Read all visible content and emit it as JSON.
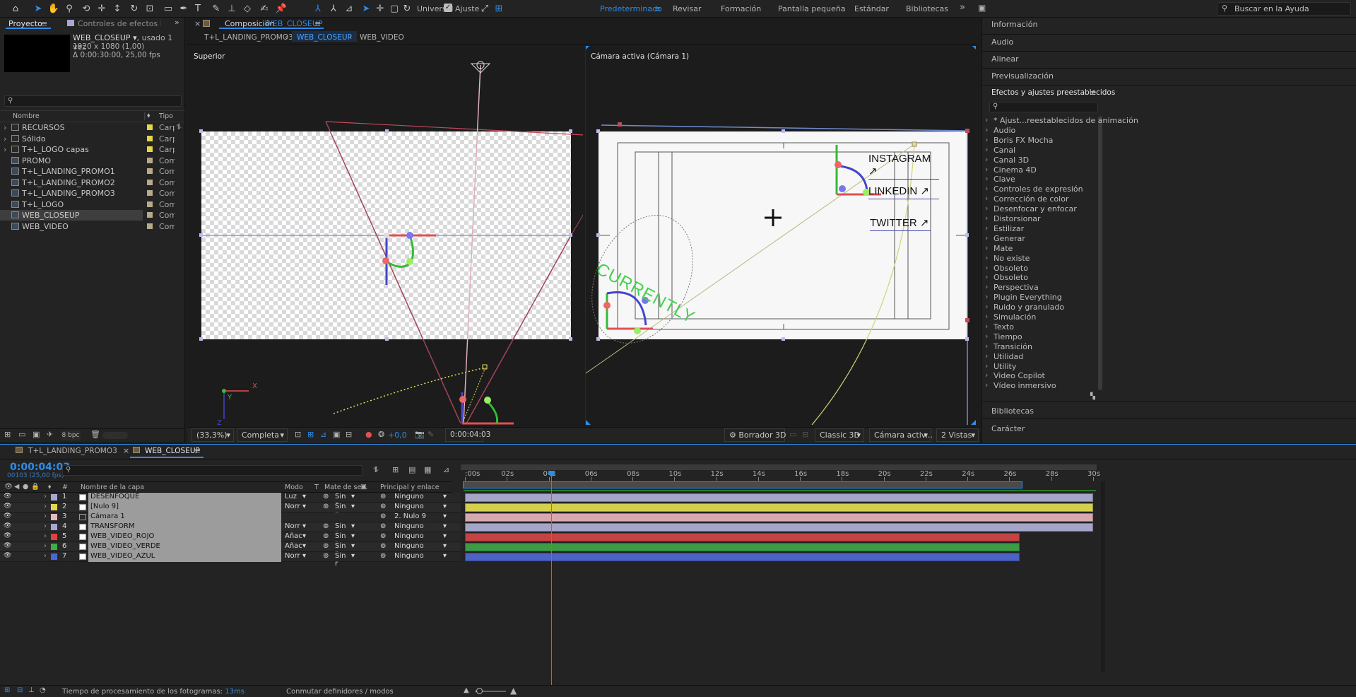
{
  "toolbar": {
    "universal_label": "Universal",
    "snap_label": "Ajuste",
    "workspaces": [
      "Predeterminado",
      "Revisar",
      "Formación",
      "Pantalla pequeña",
      "Estándar",
      "Bibliotecas"
    ],
    "search_help_placeholder": "Buscar en la Ayuda"
  },
  "project_panel": {
    "tab_project": "Proyecto",
    "tab_effects_controls": "Controles de efectos DESENFOQUE",
    "selected_name": "WEB_CLOSEUP",
    "selected_usage": ", usado 1 vez",
    "selected_dims": "1920 x 1080 (1,00)",
    "selected_duration": "Δ 0:00:30:00, 25,00 fps",
    "col_name": "Nombre",
    "col_type": "Tipo",
    "items": [
      {
        "name": "RECURSOS",
        "type": "Carpeta",
        "kind": "folder"
      },
      {
        "name": "Sólido",
        "type": "Carpeta",
        "kind": "folder"
      },
      {
        "name": "T+L_LOGO capas",
        "type": "Carpeta",
        "kind": "folder"
      },
      {
        "name": "PROMO",
        "type": "Comp",
        "kind": "comp"
      },
      {
        "name": "T+L_LANDING_PROMO1",
        "type": "Comp",
        "kind": "comp"
      },
      {
        "name": "T+L_LANDING_PROMO2",
        "type": "Comp",
        "kind": "comp"
      },
      {
        "name": "T+L_LANDING_PROMO3",
        "type": "Comp",
        "kind": "comp"
      },
      {
        "name": "T+L_LOGO",
        "type": "Comp",
        "kind": "comp"
      },
      {
        "name": "WEB_CLOSEUP",
        "type": "Comp",
        "kind": "comp",
        "selected": true
      },
      {
        "name": "WEB_VIDEO",
        "type": "Comp",
        "kind": "comp"
      }
    ],
    "bpc_label": "8 bpc"
  },
  "composition": {
    "tab_prefix": "Composición",
    "tab_name": "WEB_CLOSEUP",
    "breadcrumbs": [
      "T+L_LANDING_PROMO3",
      "WEB_CLOSEUP",
      "WEB_VIDEO"
    ],
    "view_left_label": "Superior",
    "view_right_label": "Cámara activa (Cámara 1)",
    "social_links": [
      "INSTAGRAM ↗",
      "LINKEDIN ↗",
      "TWITTER ↗"
    ],
    "curved_text": "CURRENTLY",
    "axis_x": "X",
    "axis_y": "Y",
    "axis_z": "Z",
    "controls": {
      "zoom": "(33,3%)",
      "resolution": "Completa",
      "exposure": "+0,0",
      "timecode": "0:00:04:03",
      "draft3d": "Borrador 3D",
      "renderer": "Classic 3D",
      "camera": "Cámara activ...",
      "views": "2 Vistas"
    }
  },
  "right_panels": {
    "top": [
      "Información",
      "Audio",
      "Alinear",
      "Previsualización"
    ],
    "effects_title": "Efectos y ajustes preestablecidos",
    "effects": [
      "* Ajust...reestablecidos de animación",
      "Audio",
      "Boris FX Mocha",
      "Canal",
      "Canal 3D",
      "Cinema 4D",
      "Clave",
      "Controles de expresión",
      "Corrección de color",
      "Desenfocar y enfocar",
      "Distorsionar",
      "Estilizar",
      "Generar",
      "Mate",
      "No existe",
      "Obsoleto",
      "Obsoleto",
      "Perspectiva",
      "Plugin Everything",
      "Ruido y granulado",
      "Simulación",
      "Texto",
      "Tiempo",
      "Transición",
      "Utilidad",
      "Utility",
      "Video Copilot",
      "Vídeo inmersivo"
    ],
    "bottom": [
      "Bibliotecas",
      "Carácter"
    ]
  },
  "timeline": {
    "tabs": [
      "T+L_LANDING_PROMO3",
      "WEB_CLOSEUP"
    ],
    "current_time": "0:00:04:03",
    "current_frames": "00103 (25,00 fps)",
    "headers": {
      "num": "#",
      "name": "Nombre de la capa",
      "mode": "Modo",
      "t": "T",
      "matte": "Mate de se...",
      "parent": "Principal y enlace"
    },
    "ruler": [
      ":00s",
      "02s",
      "04s",
      "06s",
      "08s",
      "10s",
      "12s",
      "14s",
      "16s",
      "18s",
      "20s",
      "22s",
      "24s",
      "26s",
      "28s",
      "30s"
    ],
    "duration_seconds": 30,
    "current_seconds": 4.12,
    "layers": [
      {
        "num": "1",
        "name": "DESENFOQUE",
        "mode": "Luz",
        "matte": "Sin r",
        "parent": "Ninguno",
        "label": "#a7a7d6",
        "bar": "#a5a5c9",
        "bar_end": 30
      },
      {
        "num": "2",
        "name": "[Nulo 9]",
        "mode": "Norr",
        "matte": "Sin r",
        "parent": "Ninguno",
        "label": "#e3d649",
        "bar": "#d4cf4f",
        "bar_end": 30
      },
      {
        "num": "3",
        "name": "Cámara 1",
        "mode": "",
        "matte": "",
        "parent": "2. Nulo 9",
        "label": "#e6b8c2",
        "bar": "#d8a8b1",
        "bar_end": 30
      },
      {
        "num": "4",
        "name": "TRANSFORM",
        "mode": "Norr",
        "matte": "Sin r",
        "parent": "Ninguno",
        "label": "#a7a7d6",
        "bar": "#a5a5c9",
        "bar_end": 30
      },
      {
        "num": "5",
        "name": "WEB_VIDEO_ROJO",
        "mode": "Añac",
        "matte": "Sin r",
        "parent": "Ninguno",
        "label": "#e2403d",
        "bar": "#c44343",
        "bar_end": 26.5
      },
      {
        "num": "6",
        "name": "WEB_VIDEO_VERDE",
        "mode": "Añac",
        "matte": "Sin r",
        "parent": "Ninguno",
        "label": "#3fae4a",
        "bar": "#3c9b46",
        "bar_end": 26.5
      },
      {
        "num": "7",
        "name": "WEB_VIDEO_AZUL",
        "mode": "Norr",
        "matte": "Sin r",
        "parent": "Ninguno",
        "label": "#4768d6",
        "bar": "#4a63c5",
        "bar_end": 26.5
      }
    ],
    "status_prefix": "Tiempo de procesamiento de los fotogramas:",
    "status_value": "13ms",
    "toggle_label": "Conmutar definidores / modos"
  }
}
